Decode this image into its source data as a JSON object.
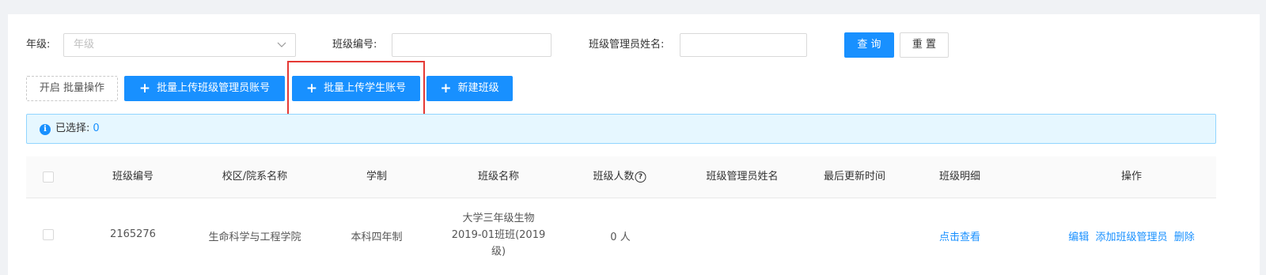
{
  "filters": {
    "grade_label": "年级:",
    "grade_placeholder": "年级",
    "class_no_label": "班级编号:",
    "class_no_value": "",
    "manager_label": "班级管理员姓名:",
    "manager_value": "",
    "query_button": "查 询",
    "reset_button": "重 置"
  },
  "toolbar": {
    "batch_toggle": "开启 批量操作",
    "upload_managers": "批量上传班级管理员账号",
    "upload_students": "批量上传学生账号",
    "new_class": "新建班级"
  },
  "alert": {
    "selected_label": "已选择:",
    "selected_count": "0"
  },
  "table": {
    "columns": [
      "班级编号",
      "校区/院系名称",
      "学制",
      "班级名称",
      "班级人数",
      "班级管理员姓名",
      "最后更新时间",
      "班级明细",
      "操作"
    ],
    "rows": [
      {
        "class_no": "2165276",
        "department": "生命科学与工程学院",
        "system": "本科四年制",
        "class_name_lines": [
          "大学三年级生物",
          "2019-01班班(2019",
          "级)"
        ],
        "count": "0 人",
        "manager": "",
        "updated": "",
        "detail": "点击查看",
        "actions": [
          "编辑",
          "添加班级管理员",
          "删除"
        ]
      }
    ]
  },
  "colors": {
    "primary": "#1890ff",
    "highlight": "#e53935"
  }
}
